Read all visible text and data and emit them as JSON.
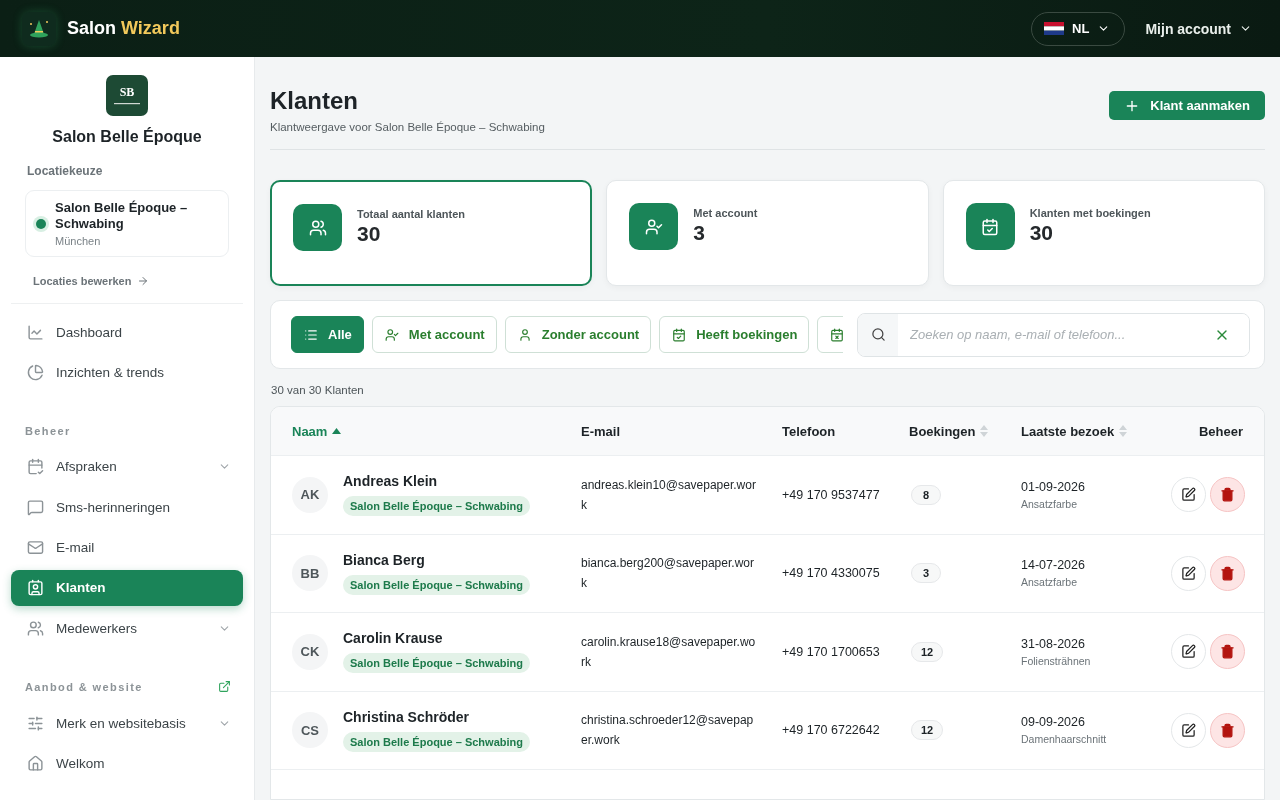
{
  "header": {
    "brand": {
      "name": "Salon",
      "accent": "Wizard"
    },
    "language": {
      "code": "NL"
    },
    "account": {
      "label": "Mijn account"
    }
  },
  "sidebar": {
    "salon": {
      "logo_text": "SB",
      "name": "Salon Belle Époque"
    },
    "location": {
      "heading": "Locatiekeuze",
      "name": "Salon Belle Époque – Schwabing",
      "city": "München",
      "selected": true,
      "edit_link": "Locaties bewerken"
    },
    "sections": [
      {
        "items": [
          {
            "label": "Dashboard",
            "selected": false,
            "submenu": false
          },
          {
            "label": "Inzichten & trends",
            "selected": false,
            "submenu": false
          }
        ]
      },
      {
        "title": "Beheer",
        "external_link": false,
        "items": [
          {
            "label": "Afspraken",
            "selected": false,
            "submenu": true
          },
          {
            "label": "Sms-herinneringen",
            "selected": false,
            "submenu": false
          },
          {
            "label": "E-mail",
            "selected": false,
            "submenu": false
          },
          {
            "label": "Klanten",
            "selected": true,
            "submenu": false
          },
          {
            "label": "Medewerkers",
            "selected": false,
            "submenu": true
          }
        ]
      },
      {
        "title": "Aanbod & website",
        "external_link": true,
        "items": [
          {
            "label": "Merk en websitebasis",
            "selected": false,
            "submenu": true
          },
          {
            "label": "Welkom",
            "selected": false,
            "submenu": false
          }
        ]
      }
    ]
  },
  "page": {
    "title": "Klanten",
    "subtitle": "Klantweergave voor Salon Belle Époque – Schwabing",
    "create_button": "Klant aanmaken"
  },
  "stats": [
    {
      "label": "Totaal aantal klanten",
      "value": "30",
      "selected": true
    },
    {
      "label": "Met account",
      "value": "3",
      "selected": false
    },
    {
      "label": "Klanten met boekingen",
      "value": "30",
      "selected": false
    }
  ],
  "filters": [
    {
      "label": "Alle",
      "selected": true
    },
    {
      "label": "Met account",
      "selected": false
    },
    {
      "label": "Zonder account",
      "selected": false
    },
    {
      "label": "Heeft boekingen",
      "selected": false
    },
    {
      "selected": false
    }
  ],
  "search": {
    "placeholder": "Zoeken op naam, e-mail of telefoon..."
  },
  "result_count": "30 van 30 Klanten",
  "table": {
    "columns": [
      {
        "label": "Naam",
        "sortable": true,
        "sorted": true
      },
      {
        "label": "E-mail",
        "sortable": false
      },
      {
        "label": "Telefoon",
        "sortable": false
      },
      {
        "label": "Boekingen",
        "sortable": true,
        "sorted": false
      },
      {
        "label": "Laatste bezoek",
        "sortable": true,
        "sorted": false
      },
      {
        "label": "Beheer",
        "sortable": false
      }
    ],
    "rows": [
      {
        "initials": "AK",
        "name": "Andreas Klein",
        "location": "Salon Belle Époque – Schwabing",
        "email": "andreas.klein10@savepaper.work",
        "phone": "+49 170 9537477",
        "bookings": "8",
        "last_visit": "01-09-2026",
        "service": "Ansatzfarbe"
      },
      {
        "initials": "BB",
        "name": "Bianca Berg",
        "location": "Salon Belle Époque – Schwabing",
        "email": "bianca.berg200@savepaper.work",
        "phone": "+49 170 4330075",
        "bookings": "3",
        "last_visit": "14-07-2026",
        "service": "Ansatzfarbe"
      },
      {
        "initials": "CK",
        "name": "Carolin Krause",
        "location": "Salon Belle Époque – Schwabing",
        "email": "carolin.krause18@savepaper.work",
        "phone": "+49 170 1700653",
        "bookings": "12",
        "last_visit": "31-08-2026",
        "service": "Foliensträhnen"
      },
      {
        "initials": "CS",
        "name": "Christina Schröder",
        "location": "Salon Belle Époque – Schwabing",
        "email": "christina.schroeder12@savepaper.work",
        "phone": "+49 170 6722642",
        "bookings": "12",
        "last_visit": "09-09-2026",
        "service": "Damenhaarschnitt"
      }
    ]
  }
}
